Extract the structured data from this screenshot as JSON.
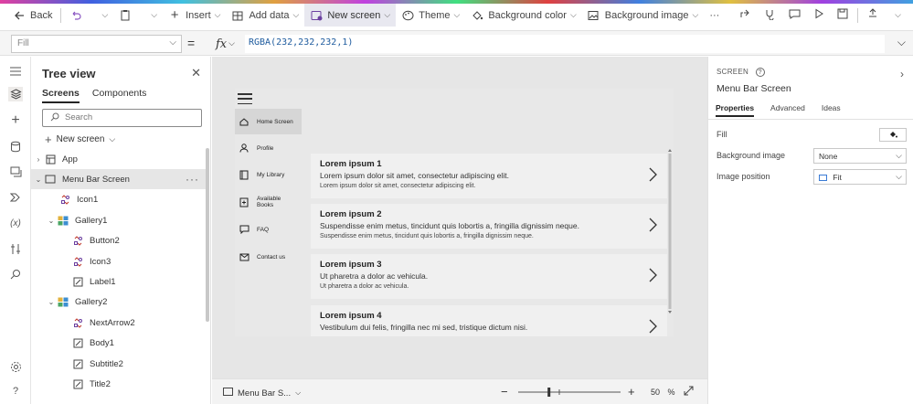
{
  "toolbar": {
    "back": "Back",
    "insert": "Insert",
    "add_data": "Add data",
    "new_screen": "New screen",
    "theme": "Theme",
    "background_color": "Background color",
    "background_image": "Background image",
    "more": "···"
  },
  "formula": {
    "property": "Fill",
    "equals": "=",
    "fx": "fx",
    "expression": "RGBA(232,232,232,1)"
  },
  "tree": {
    "title": "Tree view",
    "tabs": [
      "Screens",
      "Components"
    ],
    "search_placeholder": "Search",
    "new_screen": "New screen",
    "nodes": [
      "App",
      "Menu Bar Screen",
      "Icon1",
      "Gallery1",
      "Button2",
      "Icon3",
      "Label1",
      "Gallery2",
      "NextArrow2",
      "Body1",
      "Subtitle2",
      "Title2"
    ]
  },
  "app": {
    "menu": [
      "Home Screen",
      "Profile",
      "My Library",
      "Available Books",
      "FAQ",
      "Contact us"
    ],
    "cards": [
      {
        "title": "Lorem ipsum 1",
        "subtitle": "Lorem ipsum dolor sit amet, consectetur adipiscing elit.",
        "body": "Lorem ipsum dolor sit amet, consectetur adipiscing elit."
      },
      {
        "title": "Lorem ipsum 2",
        "subtitle": "Suspendisse enim metus, tincidunt quis lobortis a, fringilla dignissim neque.",
        "body": "Suspendisse enim metus, tincidunt quis lobortis a, fringilla dignissim neque."
      },
      {
        "title": "Lorem ipsum 3",
        "subtitle": "Ut pharetra a dolor ac vehicula.",
        "body": "Ut pharetra a dolor ac vehicula."
      },
      {
        "title": "Lorem ipsum 4",
        "subtitle": "Vestibulum dui felis, fringilla nec mi sed, tristique dictum nisi.",
        "body": ""
      }
    ]
  },
  "status": {
    "screen": "Menu Bar S...",
    "zoom_value": "50",
    "zoom_unit": "%",
    "zoom_level": 0.5
  },
  "props": {
    "label": "SCREEN",
    "name": "Menu Bar Screen",
    "tabs": [
      "Properties",
      "Advanced",
      "Ideas"
    ],
    "fill_label": "Fill",
    "bg_image_label": "Background image",
    "bg_image_value": "None",
    "img_pos_label": "Image position",
    "img_pos_value": "Fit"
  },
  "colors": {
    "accent": "#5b5fc7",
    "canvas": "#e6e6e6",
    "screen_fill": "#e8e8e8"
  }
}
